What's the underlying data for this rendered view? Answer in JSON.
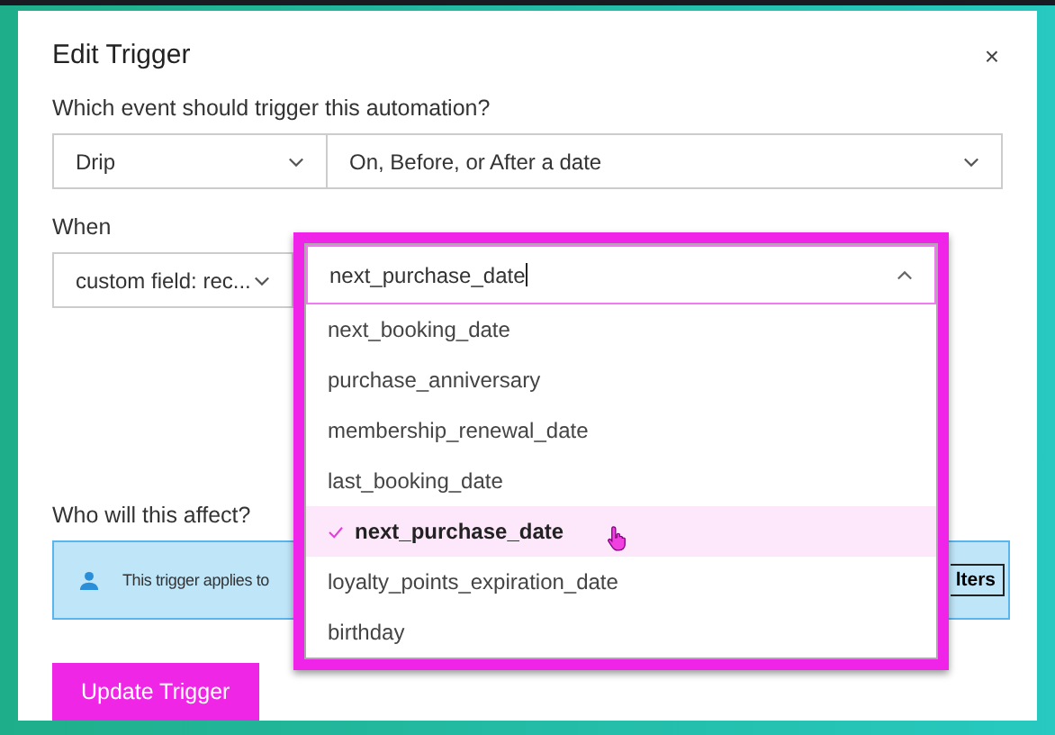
{
  "dialog": {
    "title": "Edit Trigger",
    "close": "×"
  },
  "event": {
    "label": "Which event should trigger this automation?",
    "type_select": "Drip",
    "timing_select": "On, Before, or After a date"
  },
  "when": {
    "label": "When",
    "field_select": "custom field: rec...",
    "search_value": "next_purchase_date",
    "options": [
      {
        "label": "next_booking_date",
        "selected": false
      },
      {
        "label": "purchase_anniversary",
        "selected": false
      },
      {
        "label": "membership_renewal_date",
        "selected": false
      },
      {
        "label": "last_booking_date",
        "selected": false
      },
      {
        "label": "next_purchase_date",
        "selected": true
      },
      {
        "label": "loyalty_points_expiration_date",
        "selected": false
      },
      {
        "label": "birthday",
        "selected": false
      }
    ]
  },
  "audience": {
    "label": "Who will this affect?",
    "info": "This trigger applies to",
    "filters_button": "lters"
  },
  "submit": "Update Trigger"
}
